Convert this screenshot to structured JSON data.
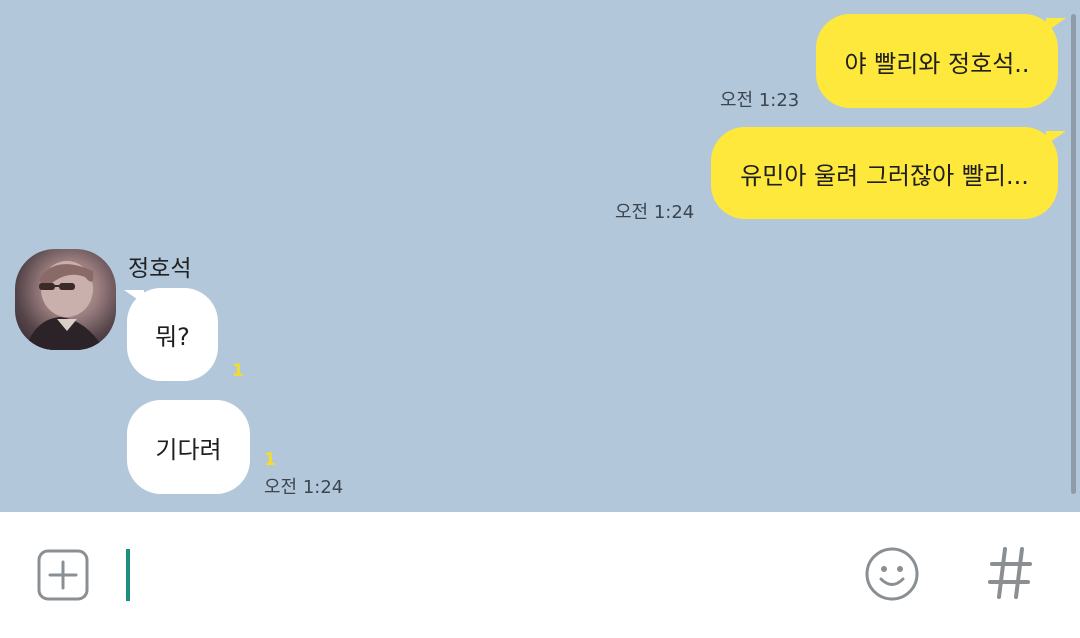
{
  "messages": {
    "m1": {
      "text": "야 빨리와 정호석..",
      "time": "오전 1:23"
    },
    "m2": {
      "text": "유민아 울려 그러잖아 빨리...",
      "time": "오전 1:24"
    },
    "sender": {
      "name": "정호석",
      "avatar_icon": "profile-photo"
    },
    "m3": {
      "text": "뭐?",
      "unread": "1"
    },
    "m4": {
      "text": "기다려",
      "unread": "1",
      "time": "오전 1:24"
    }
  },
  "composer": {
    "input_value": "",
    "icons": {
      "attach": "plus-icon",
      "emoji": "emoji-icon",
      "tag": "hash-icon"
    }
  },
  "colors": {
    "chat_background": "#b2c7da",
    "sent_bubble": "#fee83c",
    "received_bubble": "#ffffff",
    "unread_count": "#f5dc2c",
    "cursor": "#1d8f7c"
  }
}
